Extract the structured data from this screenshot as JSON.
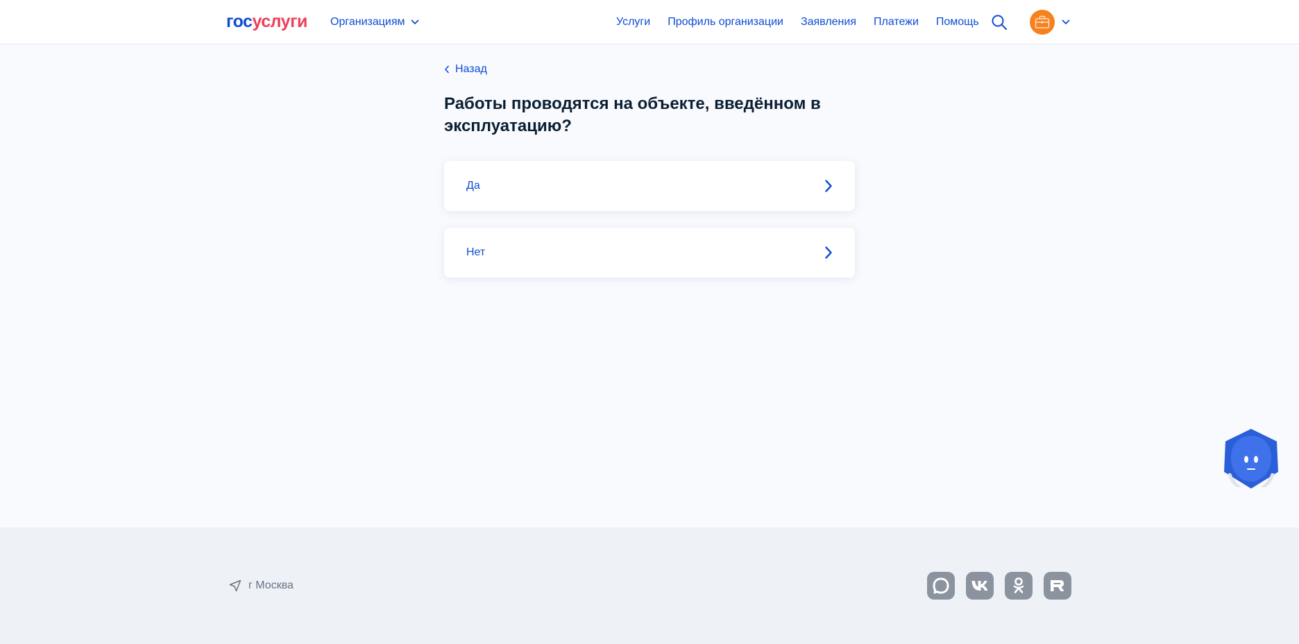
{
  "header": {
    "logo_part1": "гос",
    "logo_part2": "услуги",
    "org_switch_label": "Организациям",
    "nav": [
      "Услуги",
      "Профиль организации",
      "Заявления",
      "Платежи",
      "Помощь"
    ],
    "icons": {
      "search": "search-icon",
      "avatar": "briefcase-icon",
      "dropdown": "chevron-down-icon"
    }
  },
  "main": {
    "back_label": "Назад",
    "question": "Работы проводятся на объекте, введённом в эксплуатацию?",
    "options": [
      "Да",
      "Нет"
    ]
  },
  "footer": {
    "location": "г Москва",
    "socials": [
      "max-icon",
      "vk-icon",
      "odnoklassniki-icon",
      "rutube-icon"
    ]
  },
  "colors": {
    "accent": "#0d4cd3",
    "logo_red": "#ee3f58",
    "avatar_orange": "#f5811f",
    "page_bg": "#f8fafd",
    "footer_bg": "#eef2f7",
    "social_bg": "#8b939f"
  }
}
